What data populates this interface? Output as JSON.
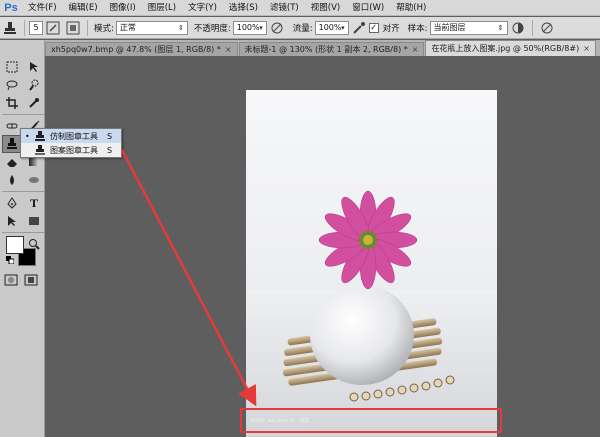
{
  "app": {
    "logo_text": "Ps"
  },
  "menubar": {
    "items": [
      "文件(F)",
      "编辑(E)",
      "图像(I)",
      "图层(L)",
      "文字(Y)",
      "选择(S)",
      "滤镜(T)",
      "视图(V)",
      "窗口(W)",
      "帮助(H)"
    ]
  },
  "options": {
    "brush_size": "5",
    "mode_label": "模式:",
    "mode_value": "正常",
    "opacity_label": "不透明度:",
    "opacity_value": "100%",
    "flow_label": "流量:",
    "flow_value": "100%",
    "aligned_label": "对齐",
    "aligned_checked": "✓",
    "sample_label": "样本:",
    "sample_value": "当前图层"
  },
  "tabs": [
    {
      "label": "xh5pq0w7.bmp @ 47.8% (图层 1, RGB/8) *"
    },
    {
      "label": "未标题-1 @ 130% (形状 1 副本 2, RGB/8) *"
    },
    {
      "label": "在花瓶上放入图案.jpg @ 50%(RGB/8#)"
    }
  ],
  "flyout": {
    "items": [
      {
        "label": "仿制图章工具",
        "key": "S",
        "bullet": "•"
      },
      {
        "label": "图案图章工具",
        "key": "S",
        "bullet": ""
      }
    ]
  },
  "photo": {
    "watermark_text": "WWW.  wel.com      fb...摄影..."
  },
  "colors": {
    "menubar_bg": "#d8d8d8",
    "canvas_bg": "#5e5e5e",
    "annotation_red": "#e63a3a",
    "flower_pink": "#d24fa0",
    "flyout_highlight": "#c9d9f0"
  }
}
